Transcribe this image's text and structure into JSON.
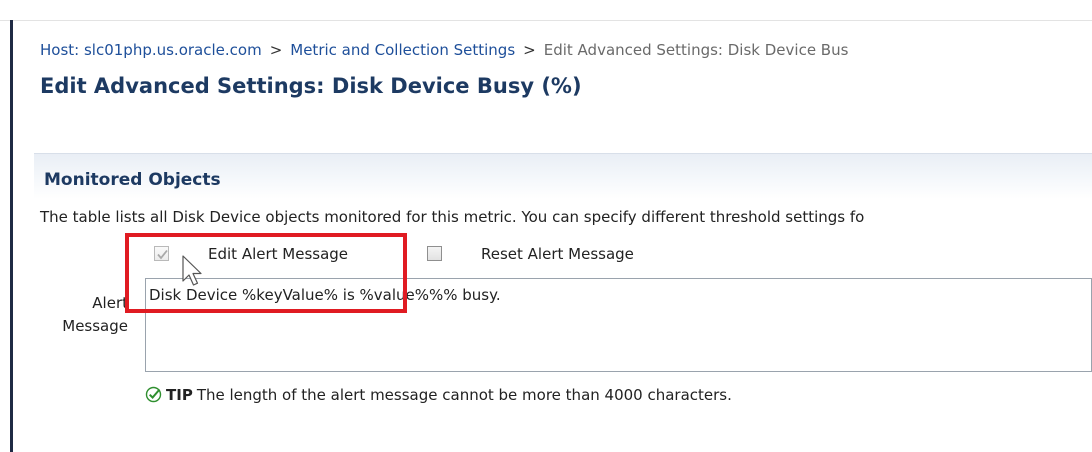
{
  "breadcrumb": {
    "host_link": "Host: slc01php.us.oracle.com",
    "separator": ">",
    "metric_link": "Metric and Collection Settings",
    "current": "Edit Advanced Settings: Disk Device Bus"
  },
  "page": {
    "title": "Edit Advanced Settings: Disk Device Busy (%)"
  },
  "monitored_objects": {
    "section_title": "Monitored Objects",
    "description": "The table lists all Disk Device objects monitored for this metric. You can specify different threshold settings fo",
    "edit_alert_message": {
      "label": "Edit Alert Message",
      "checked": true,
      "disabled": true
    },
    "reset_alert_message": {
      "label": "Reset Alert Message",
      "checked": false
    },
    "alert_message_label_line1": "Alert",
    "alert_message_label_line2": "Message",
    "alert_message_value": "Disk Device %keyValue% is %value%%% busy.",
    "tip_label": "TIP",
    "tip_text": "The length of the alert message cannot be more than 4000 characters."
  },
  "colors": {
    "link": "#1e4f9a",
    "title": "#1d3a62",
    "highlight": "#e01b22",
    "tip_check": "#2f8f2f"
  },
  "icons": {
    "check": "checkmark-icon",
    "tip": "tip-check-icon",
    "cursor": "mouse-pointer-icon"
  }
}
